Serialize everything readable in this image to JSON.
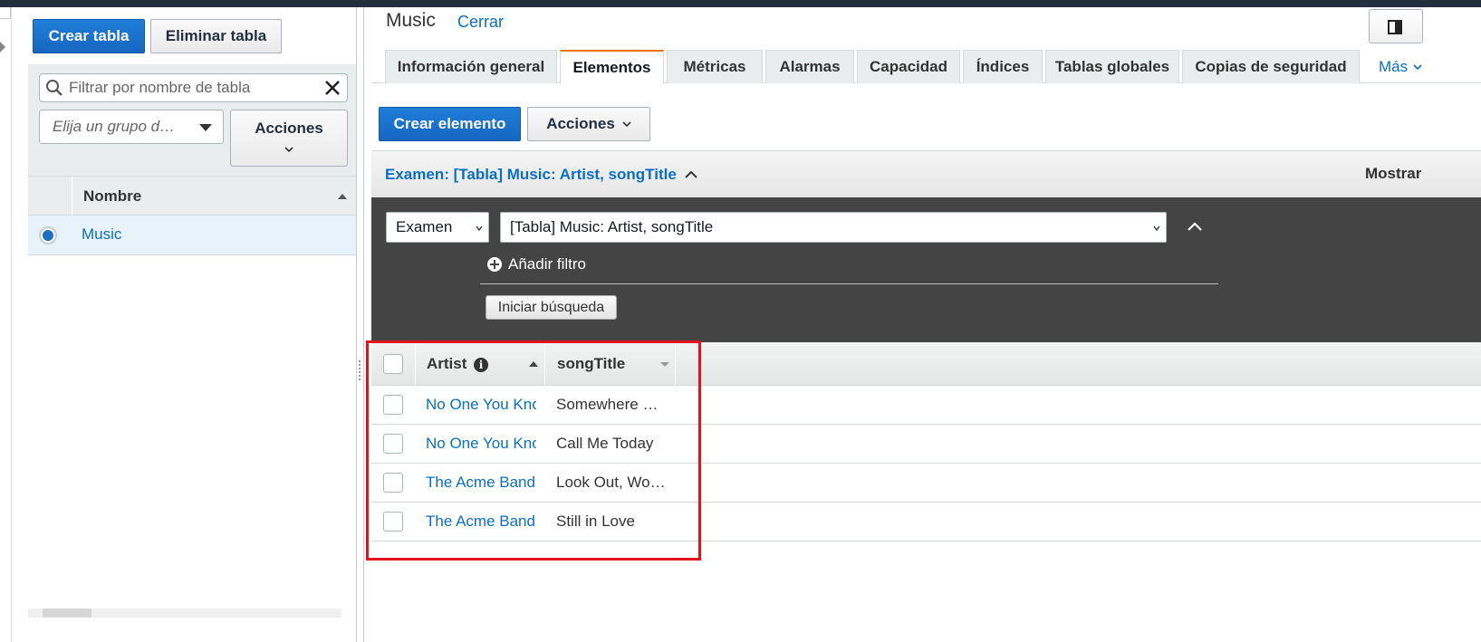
{
  "left": {
    "crear_tabla": "Crear tabla",
    "eliminar_tabla": "Eliminar tabla",
    "search_placeholder": "Filtrar por nombre de tabla",
    "group_placeholder": "Elija un grupo d…",
    "acciones": "Acciones",
    "col_nombre": "Nombre",
    "tables": [
      {
        "name": "Music",
        "selected": true
      }
    ]
  },
  "main": {
    "title": "Music",
    "cerrar": "Cerrar",
    "tabs": [
      {
        "label": "Información general",
        "active": false
      },
      {
        "label": "Elementos",
        "active": true
      },
      {
        "label": "Métricas",
        "active": false
      },
      {
        "label": "Alarmas",
        "active": false
      },
      {
        "label": "Capacidad",
        "active": false
      },
      {
        "label": "Índices",
        "active": false
      },
      {
        "label": "Tablas globales",
        "active": false
      },
      {
        "label": "Copias de seguridad",
        "active": false
      }
    ],
    "tab_more": "Más",
    "crear_elemento": "Crear elemento",
    "acciones": "Acciones",
    "exam_label": "Examen: [Tabla] Music: Artist, songTitle",
    "mostrar": "Mostrar",
    "scan_type": "Examen",
    "scan_target": "[Tabla] Music: Artist, songTitle",
    "add_filter": "Añadir filtro",
    "start_search": "Iniciar búsqueda",
    "columns": {
      "artist": "Artist",
      "song": "songTitle"
    },
    "rows": [
      {
        "artist": "No One You Know",
        "song": "Somewhere Down The Road"
      },
      {
        "artist": "No One You Know",
        "song": "Call Me Today"
      },
      {
        "artist": "The Acme Band",
        "song": "Look Out, World"
      },
      {
        "artist": "The Acme Band",
        "song": "Still in Love"
      }
    ]
  },
  "colors": {
    "primary": "#1766c0",
    "link": "#0a6fc2",
    "accent_tab": "#ec7211",
    "dark_panel": "#444444",
    "highlight": "#e0141e",
    "topbar": "#232f3e"
  }
}
